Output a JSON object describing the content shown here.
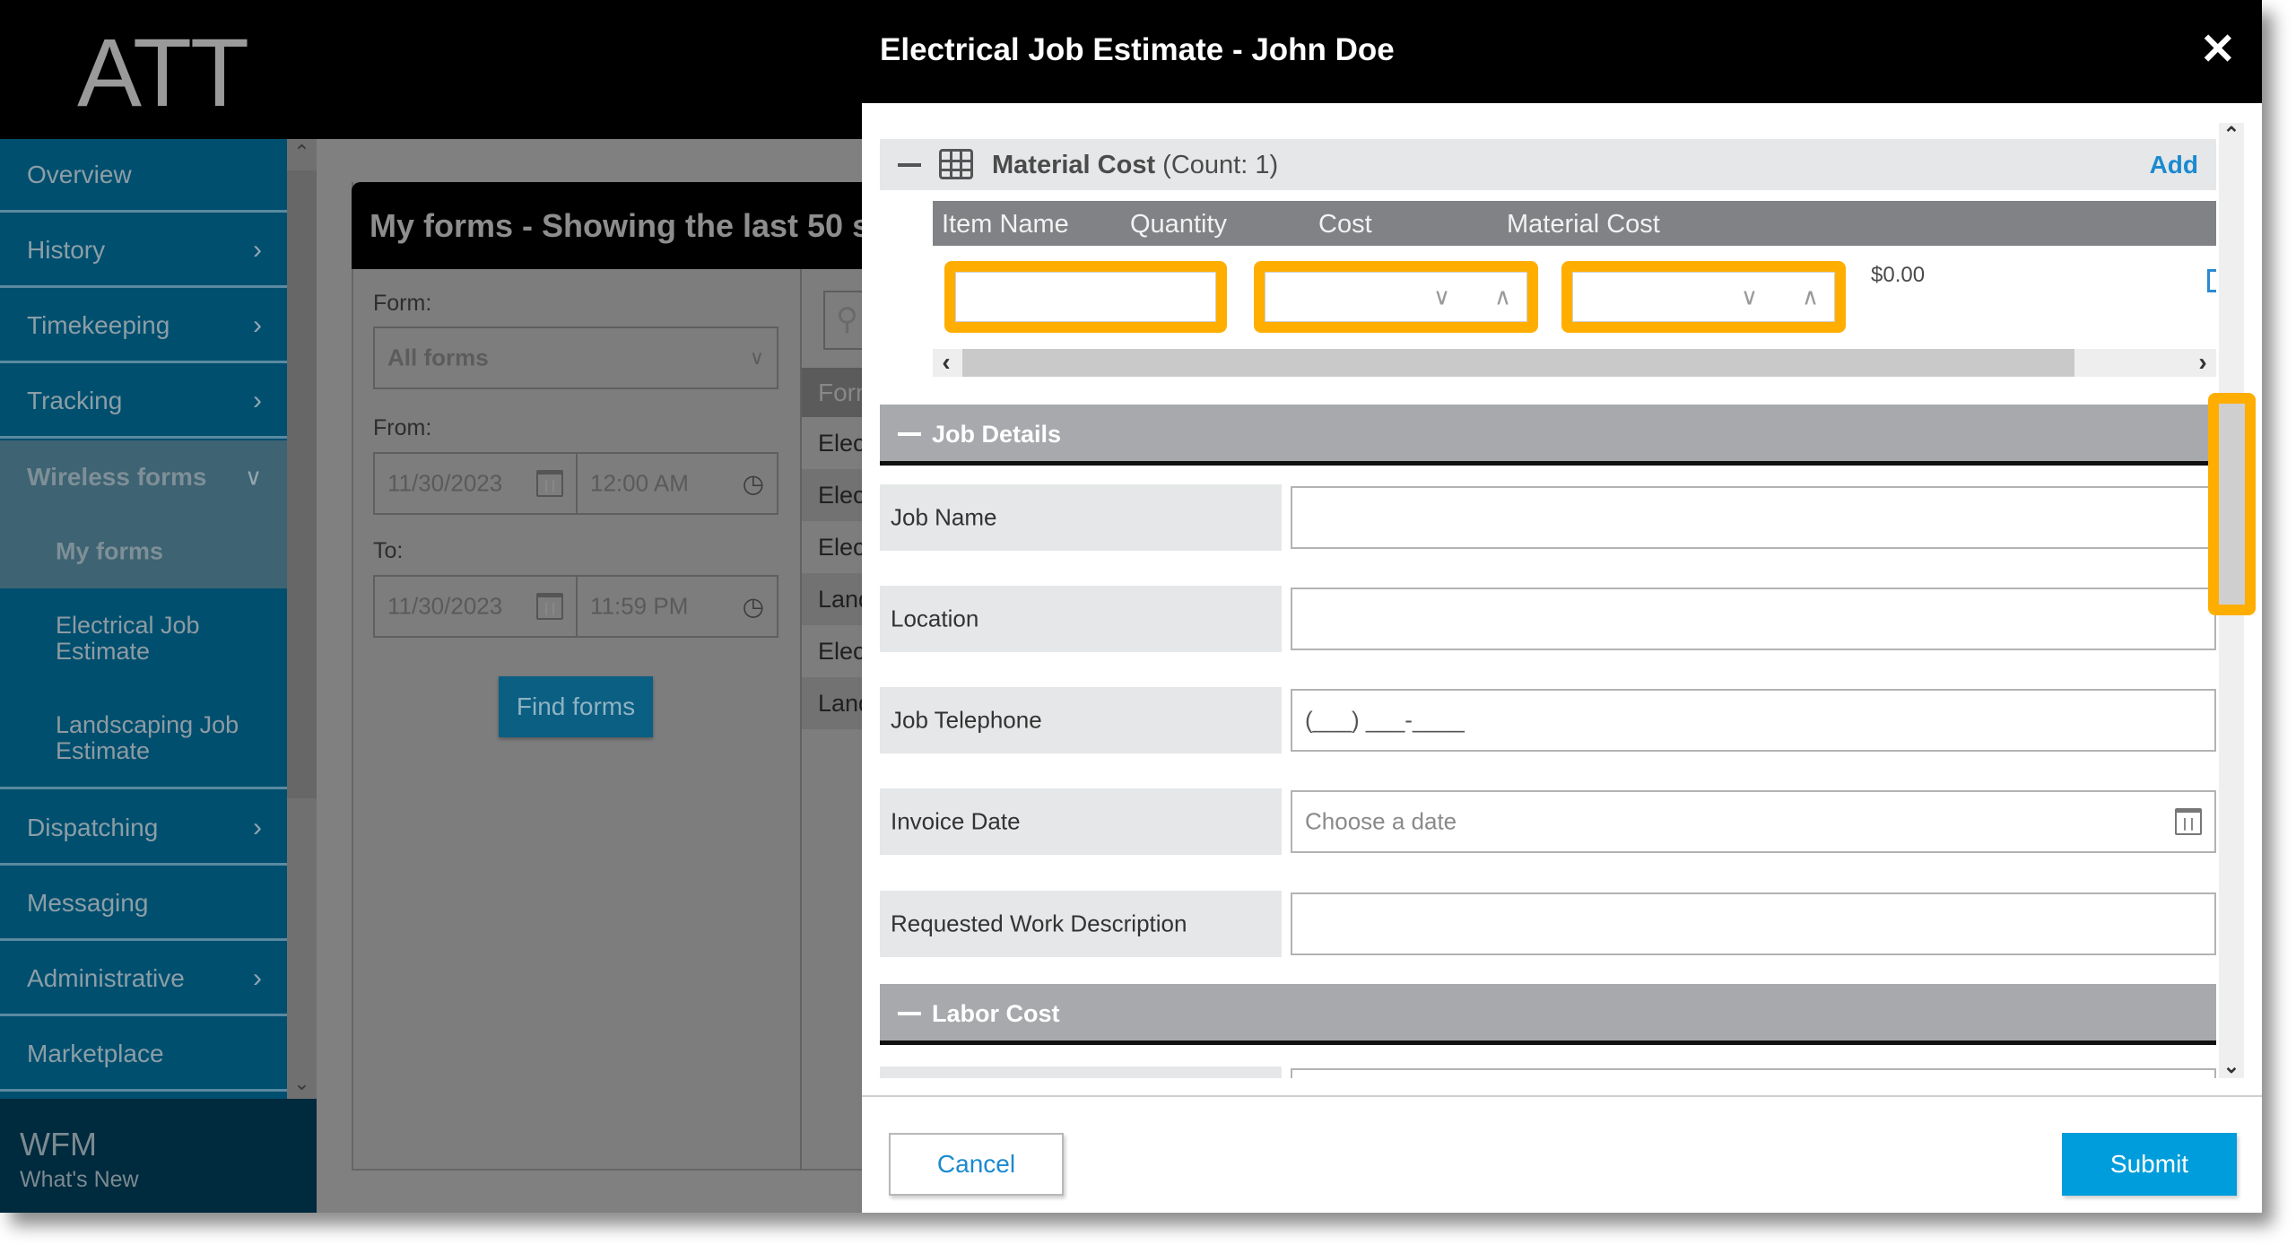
{
  "app": {
    "logo": "ATT",
    "footer_title": "WFM",
    "footer_link": "What's New"
  },
  "sidebar": {
    "items": [
      {
        "label": "Overview",
        "has_chevron": false
      },
      {
        "label": "History",
        "has_chevron": true
      },
      {
        "label": "Timekeeping",
        "has_chevron": true
      },
      {
        "label": "Tracking",
        "has_chevron": true
      },
      {
        "label": "Wireless forms",
        "expanded": true
      },
      {
        "label": "Dispatching",
        "has_chevron": true
      },
      {
        "label": "Messaging",
        "has_chevron": false
      },
      {
        "label": "Administrative",
        "has_chevron": true
      },
      {
        "label": "Marketplace",
        "has_chevron": false
      }
    ],
    "subitems": [
      {
        "label": "My forms",
        "active": true
      },
      {
        "label": "Electrical Job Estimate"
      },
      {
        "label": "Landscaping Job Estimate"
      }
    ],
    "chevron_right": "›",
    "chevron_down": "⌄"
  },
  "panel": {
    "title": "My forms - Showing the last 50 s",
    "form_label": "Form:",
    "form_value": "All forms",
    "from_label": "From:",
    "from_date": "11/30/2023",
    "from_time": "12:00 AM",
    "to_label": "To:",
    "to_date": "11/30/2023",
    "to_time": "11:59 PM",
    "find_button": "Find forms",
    "list_header": "Form",
    "list_rows": [
      "Elec",
      "Elec",
      "Elec",
      "Land",
      "Elec",
      "Land"
    ]
  },
  "modal": {
    "title": "Electrical Job Estimate - John Doe",
    "close": "✕",
    "material": {
      "title": "Material Cost",
      "count": "(Count: 1)",
      "add": "Add",
      "columns": [
        "Item Name",
        "Quantity",
        "Cost",
        "Material Cost"
      ],
      "row": {
        "item_name": "",
        "quantity": "",
        "cost": "",
        "material_cost": "$0.00"
      }
    },
    "job_details": {
      "title": "Job Details",
      "fields": [
        {
          "label": "Job Name",
          "value": "",
          "placeholder": ""
        },
        {
          "label": "Location",
          "value": "",
          "placeholder": ""
        },
        {
          "label": "Job Telephone",
          "value": "(___) ___-____",
          "placeholder": ""
        },
        {
          "label": "Invoice Date",
          "value": "",
          "placeholder": "Choose a date"
        },
        {
          "label": "Requested Work Description",
          "value": "",
          "placeholder": ""
        }
      ]
    },
    "labor": {
      "title": "Labor Cost"
    },
    "cancel": "Cancel",
    "submit": "Submit"
  },
  "colors": {
    "highlight": "#ffae00",
    "link": "#1b8ad0",
    "submit": "#009ddc",
    "sidebar": "#004f6f"
  }
}
